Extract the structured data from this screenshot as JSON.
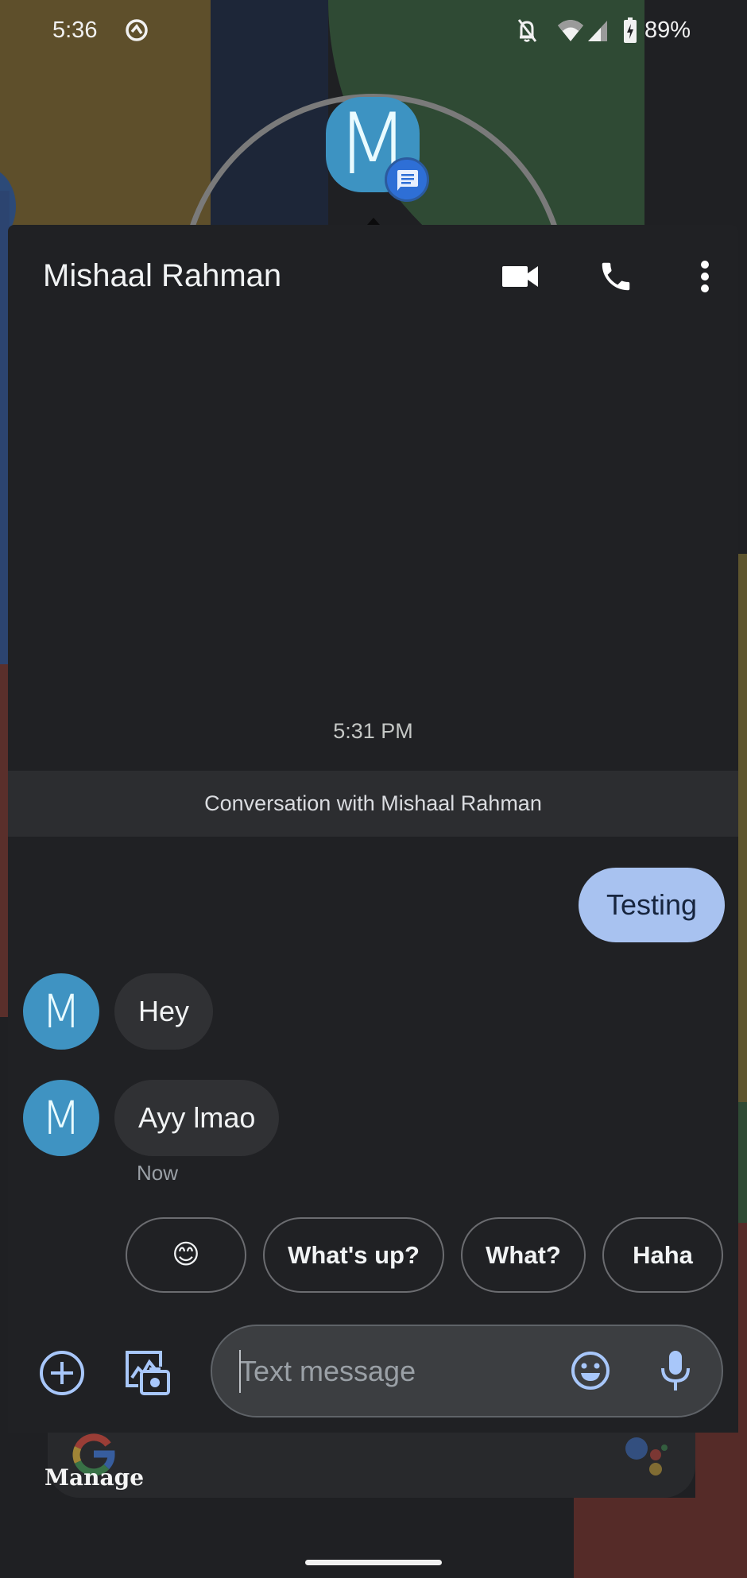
{
  "status_bar": {
    "time": "5:36",
    "battery_percent": "89%",
    "icons": [
      "android-q-icon",
      "notifications-off-icon",
      "wifi-icon",
      "cell-signal-icon",
      "battery-charging-icon"
    ]
  },
  "bubble": {
    "avatar_letter": "M",
    "badge_icon": "messages-app-icon",
    "colors": {
      "avatar": "#3d93c2",
      "badge": "#2e6fd6"
    }
  },
  "header": {
    "title": "Mishaal Rahman",
    "actions": [
      {
        "name": "video-call",
        "icon": "video-camera-icon"
      },
      {
        "name": "voice-call",
        "icon": "phone-icon"
      },
      {
        "name": "more-options",
        "icon": "more-vert-icon"
      }
    ]
  },
  "conversation": {
    "timestamp": "5:31 PM",
    "banner": "Conversation with Mishaal Rahman",
    "messages": [
      {
        "direction": "outgoing",
        "text": "Testing"
      },
      {
        "direction": "incoming",
        "sender_initial": "M",
        "text": "Hey"
      },
      {
        "direction": "incoming",
        "sender_initial": "M",
        "text": "Ayy lmao",
        "time": "Now"
      }
    ]
  },
  "smart_replies": [
    "😊",
    "What's up?",
    "What?",
    "Haha"
  ],
  "composer": {
    "placeholder": "Text message",
    "value": "",
    "actions": [
      "add-attachment",
      "gallery-camera",
      "emoji",
      "voice-input"
    ]
  },
  "home_overlay": {
    "manage_label": "Manage"
  },
  "colors": {
    "panel_bg": "#202124",
    "outgoing_bubble": "#a8c2f0",
    "incoming_bubble": "#303134",
    "accent_icons": "#a8c7fa"
  }
}
